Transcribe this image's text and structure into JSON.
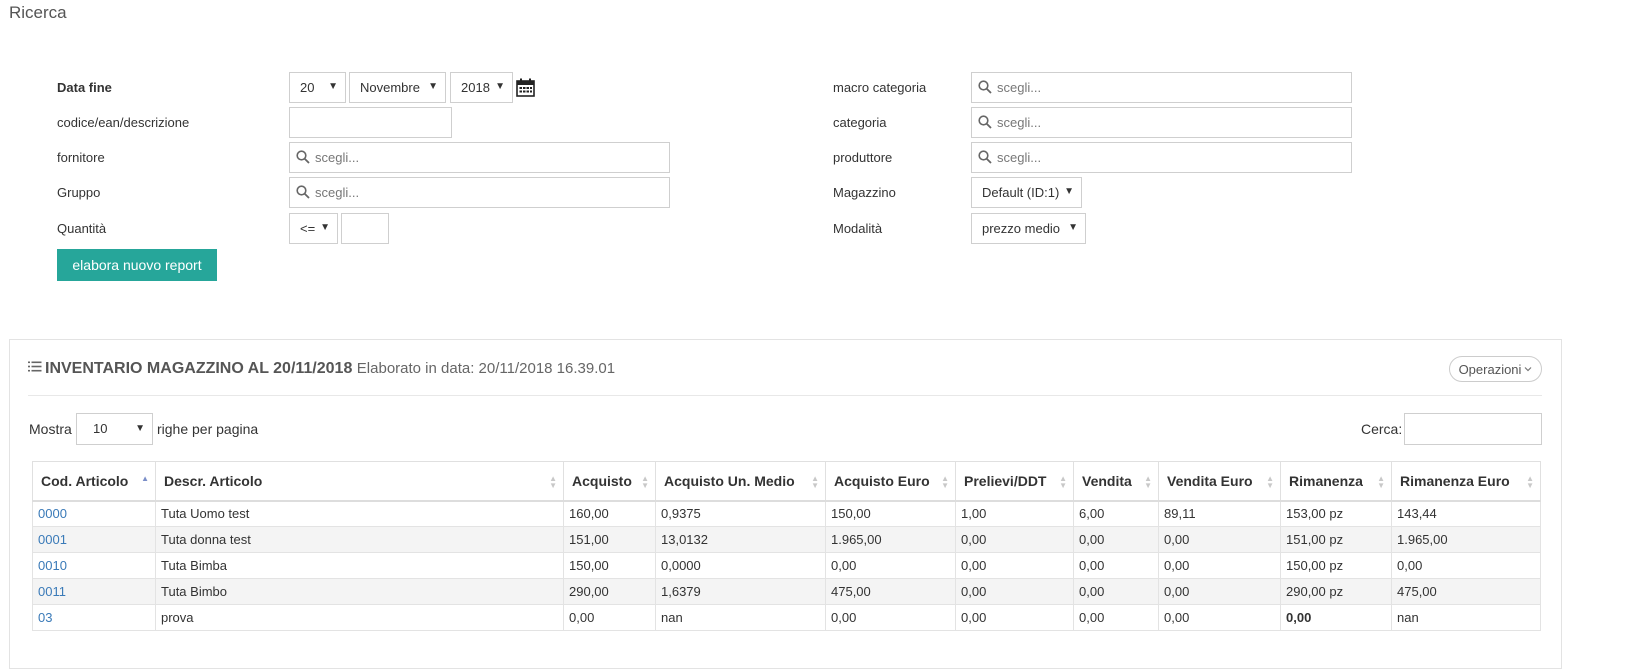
{
  "page_title": "Ricerca",
  "form": {
    "data_fine_label": "Data fine",
    "day": "20",
    "month": "Novembre",
    "year": "2018",
    "codice_label": "codice/ean/descrizione",
    "codice_value": "",
    "fornitore_label": "fornitore",
    "gruppo_label": "Gruppo",
    "quantita_label": "Quantità",
    "quantita_op": "<=",
    "quantita_value": "",
    "macro_label": "macro categoria",
    "categoria_label": "categoria",
    "produttore_label": "produttore",
    "magazzino_label": "Magazzino",
    "magazzino_value": "Default (ID:1)",
    "modalita_label": "Modalità",
    "modalita_value": "prezzo medio",
    "search_placeholder": "scegli...",
    "submit_label": "elabora nuovo report"
  },
  "report": {
    "title": "INVENTARIO MAGAZZINO AL 20/11/2018",
    "subtitle": "Elaborato in data: 20/11/2018 16.39.01",
    "ops_label": "Operazioni",
    "show_label": "Mostra",
    "page_size": "10",
    "per_page_label": "righe per pagina",
    "search_label": "Cerca:",
    "search_value": ""
  },
  "table": {
    "columns": [
      "Cod. Articolo",
      "Descr. Articolo",
      "Acquisto",
      "Acquisto Un. Medio",
      "Acquisto Euro",
      "Prelievi/DDT",
      "Vendita",
      "Vendita Euro",
      "Rimanenza",
      "Rimanenza Euro"
    ],
    "rows": [
      [
        "0000",
        "Tuta Uomo test",
        "160,00",
        "0,9375",
        "150,00",
        "1,00",
        "6,00",
        "89,11",
        "153,00 pz",
        "143,44"
      ],
      [
        "0001",
        "Tuta donna test",
        "151,00",
        "13,0132",
        "1.965,00",
        "0,00",
        "0,00",
        "0,00",
        "151,00 pz",
        "1.965,00"
      ],
      [
        "0010",
        "Tuta Bimba",
        "150,00",
        "0,0000",
        "0,00",
        "0,00",
        "0,00",
        "0,00",
        "150,00 pz",
        "0,00"
      ],
      [
        "0011",
        "Tuta Bimbo",
        "290,00",
        "1,6379",
        "475,00",
        "0,00",
        "0,00",
        "0,00",
        "290,00 pz",
        "475,00"
      ],
      [
        "03",
        "prova",
        "0,00",
        "nan",
        "0,00",
        "0,00",
        "0,00",
        "0,00",
        "0,00",
        "nan"
      ]
    ]
  },
  "colors": {
    "primary": "#26a69a",
    "link": "#3a7ab8",
    "negative": "#e0201a"
  }
}
